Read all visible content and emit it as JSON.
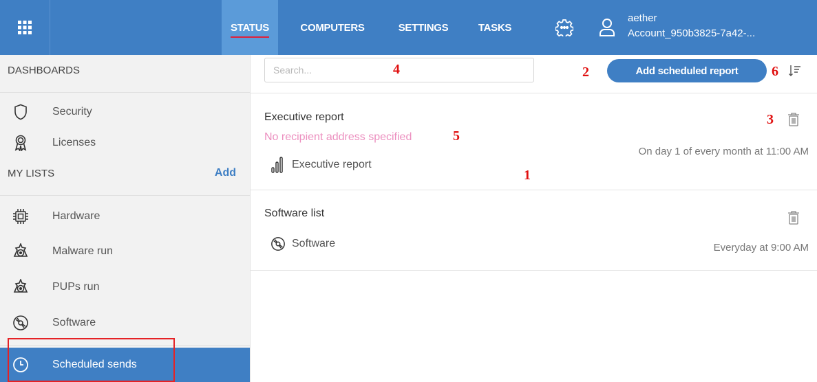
{
  "topbar": {
    "menu_icon": "grid-icon",
    "nav": [
      {
        "label": "STATUS",
        "active": true
      },
      {
        "label": "COMPUTERS",
        "active": false
      },
      {
        "label": "SETTINGS",
        "active": false
      },
      {
        "label": "TASKS",
        "active": false
      }
    ],
    "settings_icon": "gear-icon",
    "user_icon": "user-icon",
    "account": {
      "name": "aether",
      "id": "Account_950b3825-7a42-..."
    }
  },
  "sidebar": {
    "dashboards_title": "DASHBOARDS",
    "dashboards": [
      {
        "label": "Security",
        "icon": "shield-icon"
      },
      {
        "label": "Licenses",
        "icon": "award-icon"
      }
    ],
    "lists_title": "MY LISTS",
    "lists_add": "Add",
    "lists": [
      {
        "label": "Hardware",
        "icon": "chip-icon"
      },
      {
        "label": "Malware run",
        "icon": "malware-icon"
      },
      {
        "label": "PUPs run",
        "icon": "pup-icon"
      },
      {
        "label": "Software",
        "icon": "disc-icon"
      },
      {
        "label": "Scheduled sends",
        "icon": "clock-icon",
        "active": true
      }
    ]
  },
  "main": {
    "search": {
      "placeholder": "Search...",
      "value": ""
    },
    "add_button": "Add scheduled report",
    "sort_icon": "sort-icon",
    "reports": [
      {
        "title": "Executive report",
        "warning": "No recipient address specified",
        "type_label": "Executive report",
        "type_icon": "bar-chart-icon",
        "schedule": "On day 1 of every month at 11:00 AM"
      },
      {
        "title": "Software list",
        "warning": "",
        "type_label": "Software",
        "type_icon": "disc-icon",
        "schedule": "Everyday at 9:00 AM"
      }
    ]
  },
  "annotations": [
    "1",
    "2",
    "3",
    "4",
    "5",
    "6"
  ],
  "colors": {
    "accent": "#3f7fc4",
    "active_nav": "#5b9bd9",
    "warning": "#ec8fbf",
    "annotation": "#e01010"
  }
}
